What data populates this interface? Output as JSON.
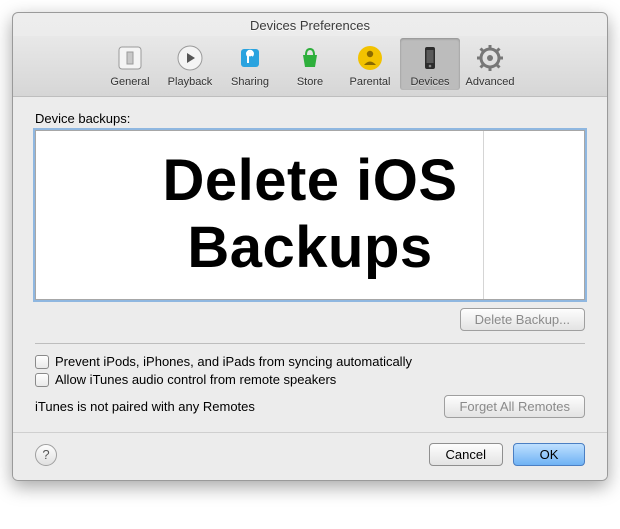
{
  "window": {
    "title": "Devices Preferences"
  },
  "toolbar": {
    "items": [
      {
        "label": "General"
      },
      {
        "label": "Playback"
      },
      {
        "label": "Sharing"
      },
      {
        "label": "Store"
      },
      {
        "label": "Parental"
      },
      {
        "label": "Devices"
      },
      {
        "label": "Advanced"
      }
    ]
  },
  "section": {
    "backups_label": "Device backups:",
    "overlay_text": "Delete iOS Backups"
  },
  "buttons": {
    "delete_backup": "Delete Backup...",
    "forget_remotes": "Forget All Remotes",
    "cancel": "Cancel",
    "ok": "OK"
  },
  "checkboxes": {
    "prevent_sync": "Prevent iPods, iPhones, and iPads from syncing automatically",
    "allow_remote_audio": "Allow iTunes audio control from remote speakers"
  },
  "status": {
    "remotes": "iTunes is not paired with any Remotes"
  },
  "help": {
    "symbol": "?"
  }
}
